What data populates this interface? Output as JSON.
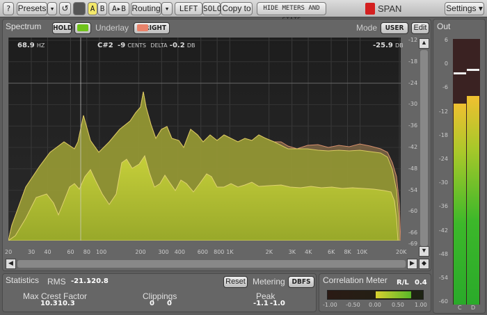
{
  "toolbar": {
    "help": "?",
    "presets": "Presets",
    "dropdown": "▾",
    "reset": "↺",
    "a": "A",
    "b": "B",
    "a_to_b": "A▸B",
    "routing": "Routing",
    "left": "LEFT",
    "solo": "SOLO",
    "copy_to": "Copy to",
    "hide_meters": "HIDE METERS AND STATS",
    "logo": "SPAN",
    "settings": "Settings ▾"
  },
  "spectrum": {
    "tab": "Spectrum",
    "hold": "HOLD",
    "underlay": "Underlay",
    "right": "RIGHT",
    "mode_label": "Mode",
    "mode": "USER",
    "edit": "Edit",
    "readout": {
      "freq": "68.9",
      "freq_unit": "HZ",
      "note": "C#2",
      "cents": "-9",
      "cents_unit": "CENTS",
      "delta_label": "DELTA",
      "delta": "-0.2",
      "delta_unit": "DB",
      "level": "-25.9",
      "level_unit": "DB"
    },
    "db_ticks": [
      "-12",
      "-18",
      "-24",
      "-30",
      "-36",
      "-42",
      "-48",
      "-54",
      "-60",
      "-66",
      "-69"
    ],
    "freq_ticks": [
      "20",
      "30",
      "40",
      "60",
      "80",
      "100",
      "200",
      "300",
      "400",
      "600",
      "800",
      "1K",
      "2K",
      "3K",
      "4K",
      "6K",
      "8K",
      "10K",
      "20K"
    ],
    "colors": {
      "main": "#a8b22e",
      "underlay": "#8a6a50",
      "hold_swatch": "#6fc21a",
      "underlay_swatch": "#e8826a"
    }
  },
  "out": {
    "tab": "Out",
    "scale": [
      "6",
      "0",
      "-6",
      "-12",
      "-18",
      "-24",
      "-30",
      "-36",
      "-42",
      "-48",
      "-54",
      "-60"
    ],
    "channels": [
      "C",
      "D"
    ],
    "levels_db": [
      -10,
      -8
    ],
    "peak_hold_db": [
      -2.5,
      -1.5
    ]
  },
  "stats": {
    "tab": "Statistics",
    "rms_label": "RMS",
    "rms": [
      "-21.1",
      "-20.8"
    ],
    "reset": "Reset",
    "metering_label": "Metering",
    "metering": "DBFS",
    "crest_label": "Max Crest Factor",
    "crest": [
      "10.3",
      "10.3"
    ],
    "clip_label": "Clippings",
    "clip": [
      "0",
      "0"
    ],
    "peak_label": "Peak",
    "peak": [
      "-1.1",
      "-1.0"
    ]
  },
  "correlation": {
    "tab": "Correlation Meter",
    "rl_label": "R/L",
    "rl": "0.4",
    "scale": [
      "-1.00",
      "-0.50",
      "0.00",
      "0.50",
      "1.00"
    ],
    "range": [
      0.0,
      0.75
    ]
  }
}
